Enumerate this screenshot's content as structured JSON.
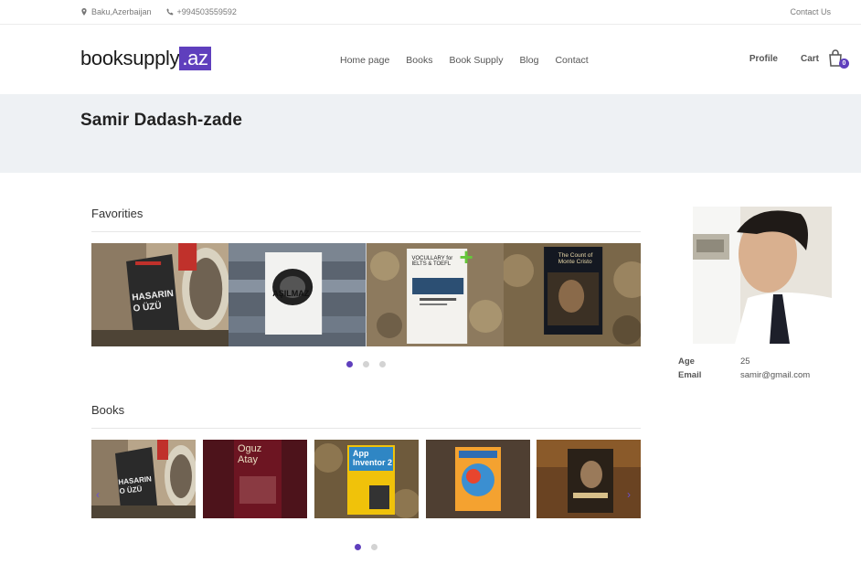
{
  "topbar": {
    "location": "Baku,Azerbaijan",
    "phone": "+994503559592",
    "contact_link": "Contact Us"
  },
  "header": {
    "logo_main": "booksupply",
    "logo_tld": ".az",
    "nav": [
      "Home page",
      "Books",
      "Book Supply",
      "Blog",
      "Contact"
    ],
    "profile_label": "Profile",
    "cart_label": "Cart",
    "cart_count": "0"
  },
  "page_title": "Samir Dadash-zade",
  "favorites": {
    "title": "Favorities",
    "covers": [
      {
        "text": "HASARIN O ÜZÜ",
        "icon": "book-cover"
      },
      {
        "text": "AŞILMAZ",
        "icon": "book-cover"
      },
      {
        "text": "VOCULLARY for IELTS & TOEFL",
        "icon": "book-cover"
      },
      {
        "text": "The Count of Monte Cristo",
        "icon": "book-cover"
      }
    ],
    "dots": 3,
    "active_dot": 0
  },
  "books": {
    "title": "Books",
    "covers": [
      {
        "text": "HASARIN O ÜZÜ"
      },
      {
        "text": "Oguz Atay"
      },
      {
        "text": "App Inventor 2"
      },
      {
        "text": "Book cover"
      },
      {
        "text": "Book cover"
      }
    ],
    "dots": 2,
    "active_dot": 0
  },
  "profile": {
    "age_label": "Age",
    "age": "25",
    "email_label": "Email",
    "email": "samir@gmail.com"
  },
  "colors": {
    "accent": "#5f3fbd",
    "band": "#eef1f4"
  }
}
